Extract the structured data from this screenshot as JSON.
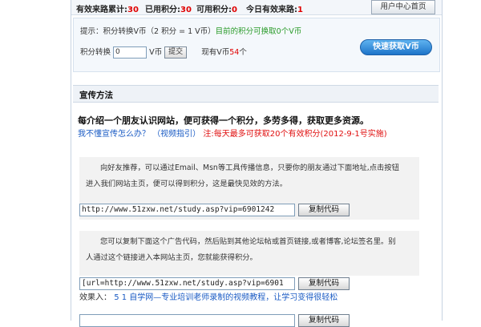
{
  "stats": {
    "effective_total_label": "有效来路累计:",
    "effective_total_value": "30",
    "used_points_label": "已用积分:",
    "used_points_value": "30",
    "available_points_label": "可用积分:",
    "available_points_value": "0",
    "today_label": "今日有效来路:",
    "today_value": "1"
  },
  "header": {
    "user_center_button": "用户中心首页"
  },
  "info": {
    "tip_prefix": "提示：",
    "tip_rate": "积分转换V币（2 积分 = 1 V币）",
    "tip_available": "目前的积分可换取0个V币",
    "convert_label": "积分转换",
    "convert_value": "0",
    "convert_unit": "V币",
    "submit_button": "提交",
    "current_vcoin_label": "现有V币",
    "current_vcoin_value": "54",
    "current_vcoin_unit": "个",
    "quick_get_button": "快速获取V币"
  },
  "section": {
    "title": "宣传方法"
  },
  "intro": {
    "headline": "每介绍一个朋友认识网站，便可获得一个积分，多劳多得，获取更多资源。",
    "link_how": "我不懂宣传怎么办？",
    "link_video": "（视频指引）",
    "note": "注:每天最多可获取20个有效积分(2012-9-1号实施)"
  },
  "method1": {
    "text_line1": "向好友推荐，可以通过Email、Msn等工具传播信息，只要你的朋友通过下面地址,点击按钮",
    "text_line2": "进入我们网站主页，便可以得到积分，这是最快见效的方法。",
    "url": "http://www.51zxw.net/study.asp?vip=6901242",
    "copy_button": "复制代码"
  },
  "method2": {
    "text_line1": "您可以复制下面这个广告代码，然后贴到其他论坛帖或首页链接,或者博客,论坛签名里。别",
    "text_line2": "人通过这个链接进入本网站主页，您就能获得积分。",
    "code": "[url=http://www.51zxw.net/study.asp?vip=6901",
    "copy_button": "复制代码"
  },
  "effect": {
    "label": "效果入：",
    "text": "5 1 自学网—专业培训老师录制的视频教程，让学习变得很轻松"
  },
  "method3": {
    "copy_button": "复制代码"
  }
}
